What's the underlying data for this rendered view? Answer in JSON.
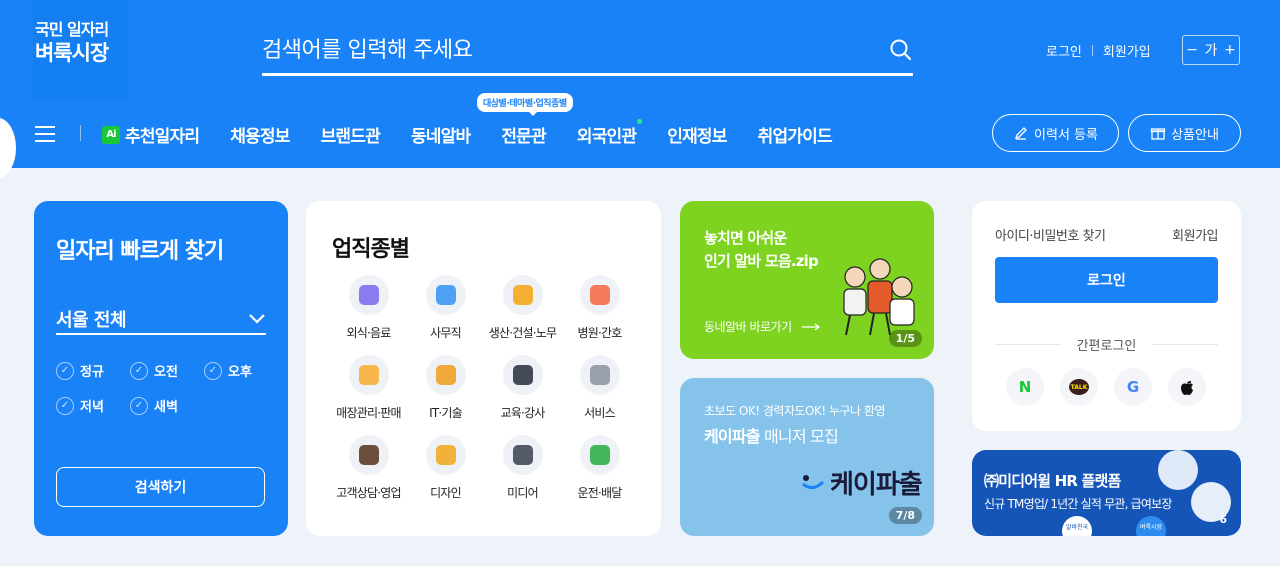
{
  "logo": {
    "line1": "국민 일자리",
    "line2": "벼룩시장"
  },
  "search": {
    "placeholder": "검색어를 입력해 주세요"
  },
  "toplinks": {
    "login": "로그인",
    "signup": "회원가입"
  },
  "fontsize": {
    "minus": "−",
    "ga": "가",
    "plus": "+"
  },
  "nav": {
    "items": [
      {
        "label": "추천일자리",
        "ai": "Ai"
      },
      {
        "label": "채용정보"
      },
      {
        "label": "브랜드관"
      },
      {
        "label": "동네알바"
      },
      {
        "label": "전문관"
      },
      {
        "label": "외국인관"
      },
      {
        "label": "인재정보"
      },
      {
        "label": "취업가이드"
      }
    ],
    "tooltip": "대상별·테마별·업직종별"
  },
  "buttons": {
    "resume": "이력서 등록",
    "product": "상품안내"
  },
  "quick": {
    "title": "일자리 빠르게 찾기",
    "region": "서울 전체",
    "options": [
      "정규",
      "오전",
      "오후",
      "저녁",
      "새벽"
    ],
    "search_label": "검색하기"
  },
  "categories": {
    "title": "업직종별",
    "items": [
      {
        "label": "외식·음료",
        "color": "#8c7bf0"
      },
      {
        "label": "사무직",
        "color": "#4ea1f5"
      },
      {
        "label": "생산·건설·노무",
        "color": "#f5b034"
      },
      {
        "label": "병원·간호",
        "color": "#f47a5b"
      },
      {
        "label": "매장관리·판매",
        "color": "#f6b64a"
      },
      {
        "label": "IT·기술",
        "color": "#f2a93b"
      },
      {
        "label": "교육·강사",
        "color": "#444a5a"
      },
      {
        "label": "서비스",
        "color": "#9aa0aa"
      },
      {
        "label": "고객상담·영업",
        "color": "#6b4f3a"
      },
      {
        "label": "디자인",
        "color": "#f1b23c"
      },
      {
        "label": "미디어",
        "color": "#555b66"
      },
      {
        "label": "운전·배달",
        "color": "#43b55a"
      }
    ]
  },
  "banner1": {
    "line1": "놓치면 아쉬운",
    "line2": "인기 알바 모음.zip",
    "link": "동네알바 바로가기",
    "pager": "1/5"
  },
  "banner2": {
    "line1": "초보도 OK! 경력자도OK! 누구나 환영",
    "line2_bold": "케이파출",
    "line2_rest": " 매니저 모집",
    "brand": "케이파출",
    "pager": "7/8"
  },
  "login": {
    "find": "아이디·비밀번호 찾기",
    "signup": "회원가입",
    "button": "로그인",
    "simple": "간편로그인"
  },
  "socials": [
    {
      "name": "naver",
      "glyph": "N",
      "color": "#19c838"
    },
    {
      "name": "kakao",
      "glyph": "TALK",
      "color": "#3a1d1d"
    },
    {
      "name": "google",
      "glyph": "G",
      "color": "#4285f4"
    },
    {
      "name": "apple",
      "glyph": "",
      "color": "#111111"
    }
  ],
  "ad": {
    "title": "㈜미디어윌 HR 플랫폼",
    "sub": "신규 TM영업/ 1년간 실적 무관, 급여보장",
    "pager": "6",
    "logo1": "알바천국",
    "logo2": "벼룩시장"
  }
}
